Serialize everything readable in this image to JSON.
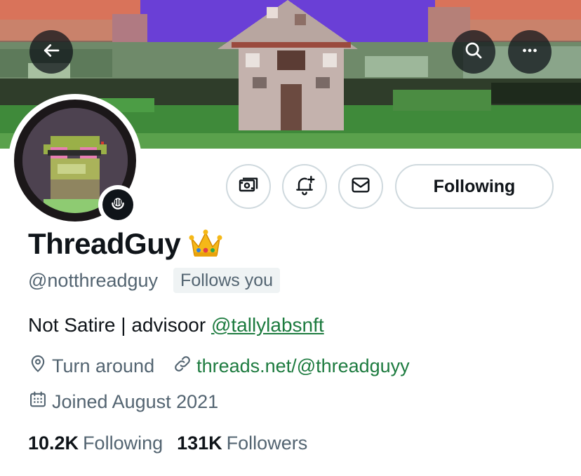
{
  "header": {
    "back_icon": "arrow-left-icon",
    "search_icon": "search-icon",
    "more_icon": "more-horizontal-icon"
  },
  "profile": {
    "display_name": "ThreadGuy",
    "badge_emoji": "crown-emoji",
    "handle": "@notthreadguy",
    "follows_you": "Follows you",
    "bio_text": "Not Satire | advisoor ",
    "bio_mention": "@tallylabsnft",
    "location": "Turn around",
    "website": "threads.net/@threadguyy",
    "joined": "Joined August 2021"
  },
  "actions": {
    "tip_icon": "money-icon",
    "notify_icon": "bell-plus-icon",
    "message_icon": "mail-icon",
    "following_label": "Following"
  },
  "stats": {
    "following_count": "10.2K",
    "following_label": "Following",
    "followers_count": "131K",
    "followers_label": "Followers"
  },
  "colors": {
    "link": "#1d7b3f",
    "secondary_text": "#536471",
    "border": "#cfd9de",
    "primary_text": "#0f1419"
  }
}
